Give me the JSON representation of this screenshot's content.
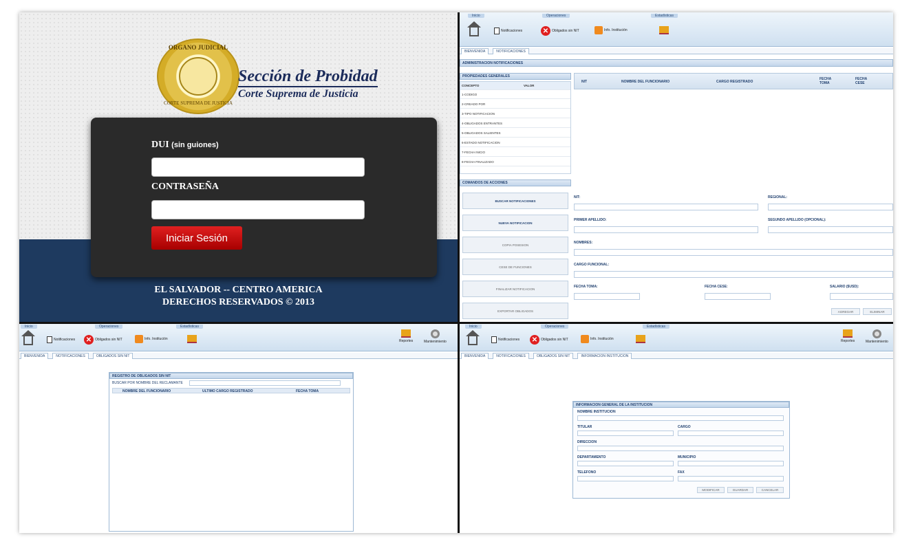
{
  "login": {
    "seal_top": "ORGANO JUDICIAL",
    "seal_bottom": "CORTE SUPREMA DE JUSTICIA",
    "brand_title": "Sección de Probidad",
    "brand_subtitle": "Corte Suprema de Justicia",
    "dui_label": "DUI",
    "dui_hint": "(sin guiones)",
    "password_label": "CONTRASEÑA",
    "submit_label": "Iniciar Sesión",
    "footer_1": "EL SALVADOR -- CENTRO AMERICA",
    "footer_2": "DERECHOS RESERVADOS © 2013"
  },
  "ribbon": {
    "group_inicio": "Inicio",
    "group_operaciones": "Operaciones",
    "group_estadisticas": "Estadísticas",
    "btn_notificaciones": "Notificaciones",
    "btn_obligados": "Obligados sin NIT",
    "btn_info_institucion": "Info. Institución",
    "btn_reportes": "Reportes",
    "btn_mantenimiento": "Mantenimiento"
  },
  "tr": {
    "tabs": [
      "BIENVENIDA",
      "NOTIFICACIONES"
    ],
    "title": "ADMINISTRACION NOTIFICACIONES",
    "props_header": "PROPIEDADES GENERALES",
    "col_concepto": "CONCEPTO",
    "col_valor": "VALOR",
    "props": [
      "1-CODIGO",
      "2-CREADO POR",
      "3-TIPO NOTIFICACION",
      "4-OBLIGADOS ENTRANTES",
      "5-OBLIGADOS SALIENTES",
      "6-ESTADO NOTIFICACION",
      "7-FECHA INICIO",
      "8-FECHA FINALIZADO"
    ],
    "grid_cols": [
      "NIT",
      "NOMBRE DEL FUNCIONARIO",
      "CARGO REGISTRADO",
      "FECHA TOMA",
      "FECHA CESE"
    ],
    "actions_header": "COMANDOS DE ACCIONES",
    "actions": [
      "BUSCAR NOTIFICACIONES",
      "NUEVA NOTIFICACION",
      "COPIA POSESION",
      "CESE DE FUNCIONES",
      "FINALIZAR NOTIFICACION",
      "EXPORTAR OBLIGADOS"
    ],
    "f_nit": "NIT:",
    "f_regional": "REGIONAL:",
    "f_primer_apellido": "PRIMER APELLIDO:",
    "f_segundo_apellido": "SEGUNDO APELLIDO (OPCIONAL):",
    "f_nombres": "NOMBRES:",
    "f_cargo": "CARGO FUNCIONAL:",
    "f_fecha_toma": "FECHA TOMA:",
    "f_fecha_cese": "FECHA CESE:",
    "f_salario": "SALARIO ($USD):",
    "btn_agregar": "AGREGAR",
    "btn_eliminar": "ELIMINAR"
  },
  "bl": {
    "tabs": [
      "BIENVENIDA",
      "NOTIFICACIONES",
      "OBLIGADOS SIN NIT"
    ],
    "panel_title": "REGISTRO DE OBLIGADOS SIN NIT",
    "search_label": "BUSCAR POR NOMBRE DEL RECLAMANTE",
    "cols": [
      "NOMBRE DEL FUNCIONARIO",
      "ULTIMO CARGO REGISTRADO",
      "FECHA TOMA"
    ]
  },
  "br": {
    "tabs": [
      "BIENVENIDA",
      "NOTIFICACIONES",
      "OBLIGADOS SIN NIT",
      "INFORMACION INSTITUCION"
    ],
    "panel_title": "INFORMACION GENERAL DE LA INSTITUCION",
    "f_nombre": "NOMBRE INSTITUCION",
    "f_titular": "TITULAR",
    "f_cargo": "CARGO",
    "f_direccion": "DIRECCION",
    "f_departamento": "DEPARTAMENTO",
    "f_municipio": "MUNICIPIO",
    "f_telefono": "TELEFONO",
    "f_fax": "FAX",
    "btn_modificar": "MODIFICAR",
    "btn_guardar": "GUARDAR",
    "btn_cancelar": "CANCELAR"
  }
}
